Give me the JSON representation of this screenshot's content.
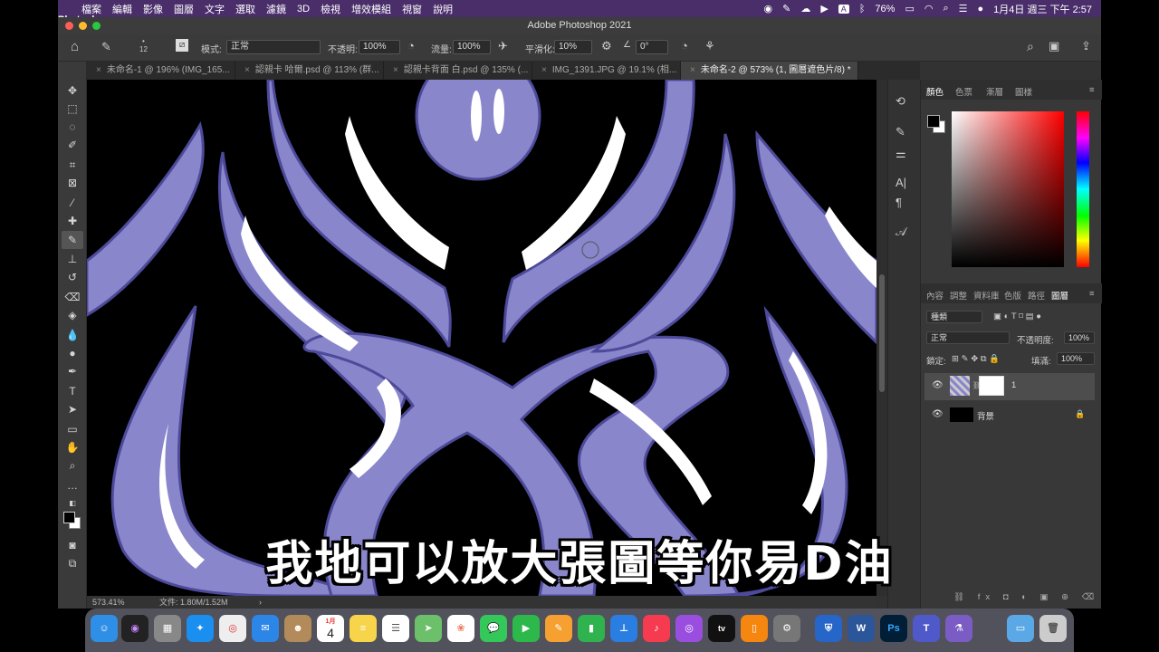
{
  "menubar": {
    "apple": "",
    "items": [
      "Photoshop",
      "檔案",
      "編輯",
      "影像",
      "圖層",
      "文字",
      "選取",
      "濾鏡",
      "3D",
      "檢視",
      "增效模組",
      "視窗",
      "說明"
    ],
    "battery": "76%",
    "datetime": "1月4日 週三 下午 2:57"
  },
  "window": {
    "title": "Adobe Photoshop 2021"
  },
  "options": {
    "brush_size": "12",
    "mode_label": "模式:",
    "mode_value": "正常",
    "opacity_label": "不透明:",
    "opacity_value": "100%",
    "flow_label": "流量:",
    "flow_value": "100%",
    "smoothing_label": "平滑化:",
    "smoothing_value": "10%",
    "angle_value": "0°"
  },
  "tabs": [
    {
      "label": "未命名-1 @ 196% (IMG_165..."
    },
    {
      "label": "認親卡 哈爾.psd @ 113% (群..."
    },
    {
      "label": "認親卡背面 白.psd @ 135% (..."
    },
    {
      "label": "IMG_1391.JPG @ 19.1% (相..."
    },
    {
      "label": "未命名-2 @ 573% (1, 圖層遮色片/8) *"
    }
  ],
  "status": {
    "zoom": "573.41%",
    "doc": "文件: 1.80M/1.52M"
  },
  "color_panel": {
    "tabs": [
      "顏色",
      "色票",
      "漸層",
      "圖樣"
    ]
  },
  "layers_panel": {
    "tabs": [
      "內容",
      "調整",
      "資料庫",
      "色版",
      "路徑",
      "圖層"
    ],
    "filter": "種類",
    "blend": "正常",
    "opacity_label": "不透明度:",
    "opacity_value": "100%",
    "lock_label": "鎖定:",
    "fill_label": "填滿:",
    "fill_value": "100%",
    "layers": [
      {
        "name": "1"
      },
      {
        "name": "背景"
      }
    ]
  },
  "subtitle": "我地可以放大張圖等你易D油",
  "colors": {
    "menubar": "#4a2e6a",
    "art_fill": "#8a86cc",
    "art_outline": "#4d4a9a"
  },
  "dock_apps": [
    "Finder",
    "Siri",
    "Launchpad",
    "Safari",
    "Chrome",
    "Mail",
    "Contacts",
    "Calendar",
    "Notes",
    "Reminders",
    "Maps",
    "Photos",
    "Messages",
    "FaceTime",
    "Pages",
    "Numbers",
    "Keynote",
    "Music",
    "Podcasts",
    "TV",
    "Books",
    "System Preferences",
    "Shield",
    "Word",
    "Photoshop",
    "Teams",
    "Potion",
    "Folder",
    "Trash"
  ],
  "dock_calendar_day": "4",
  "dock_calendar_month": "1月"
}
